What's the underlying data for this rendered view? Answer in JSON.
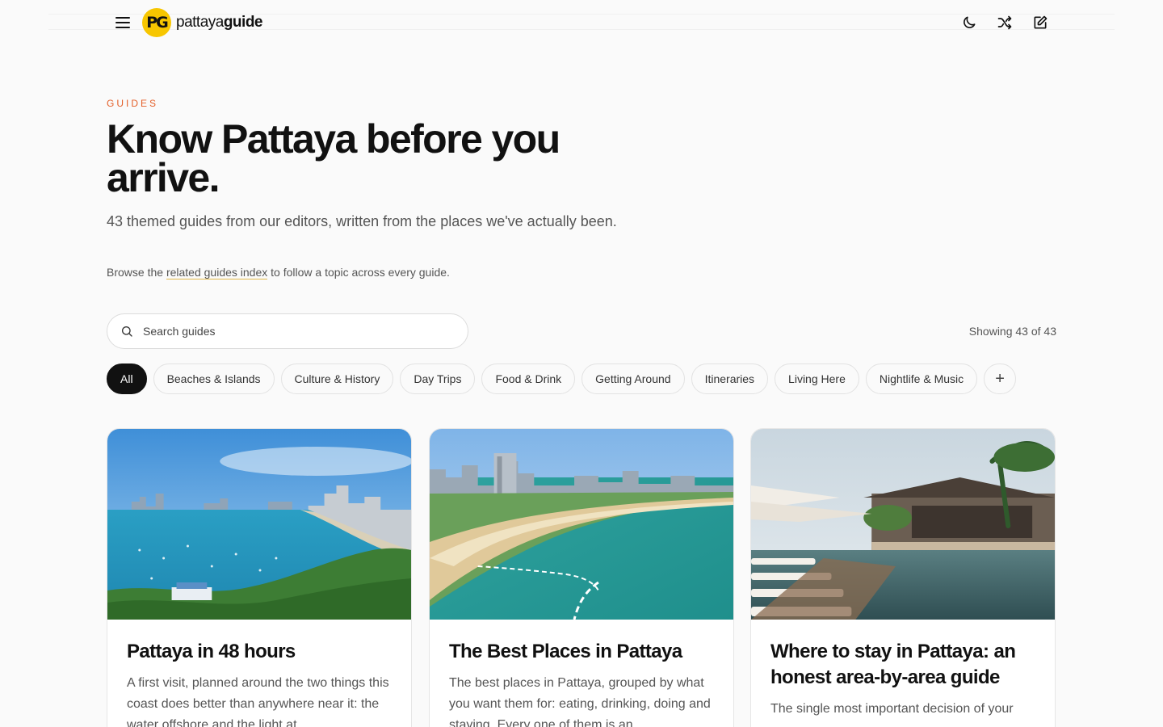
{
  "header": {
    "menu_icon": "hamburger-icon",
    "logo_mark": "PG",
    "logo_text_light": "pattaya",
    "logo_text_bold": "guide",
    "actions": [
      {
        "icon": "moon-icon"
      },
      {
        "icon": "shuffle-icon"
      },
      {
        "icon": "edit-icon"
      }
    ]
  },
  "hero": {
    "eyebrow": "GUIDES",
    "title": "Know Pattaya before you arrive.",
    "subtitle": "43 themed guides from our editors, written from the places we've actually been.",
    "note_prefix": "Browse the ",
    "note_link": "related guides index",
    "note_suffix": " to follow a topic across every guide."
  },
  "search": {
    "placeholder": "Search guides",
    "value": ""
  },
  "results": {
    "showing": "Showing 43 of 43"
  },
  "filters": [
    "All",
    "Beaches & Islands",
    "Culture & History",
    "Day Trips",
    "Food & Drink",
    "Getting Around",
    "Itineraries",
    "Living Here",
    "Nightlife & Music"
  ],
  "more_filters_label": "+",
  "cards": [
    {
      "title": "Pattaya in 48 hours",
      "description": "A first visit, planned around the two things this coast does better than anywhere near it: the water offshore and the light at"
    },
    {
      "title": "The Best Places in Pattaya",
      "description": "The best places in Pattaya, grouped by what you want them for: eating, drinking, doing and staying. Every one of them is an"
    },
    {
      "title": "Where to stay in Pattaya: an honest area-by-area guide",
      "description": "The single most important decision of your"
    }
  ],
  "colors": {
    "accent": "#e4602a",
    "brand_yellow": "#f7c600",
    "text": "#111111",
    "muted": "#555555"
  }
}
